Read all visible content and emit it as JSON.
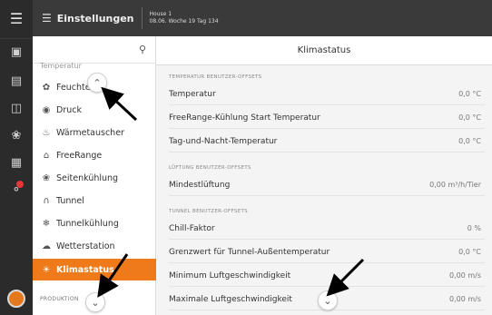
{
  "header": {
    "title": "Einstellungen",
    "house": "House 1",
    "date_line": "08.06. Woche 19 Tag 134"
  },
  "rail": {
    "icons": [
      "menu-icon",
      "dashboard-icon",
      "chart-icon",
      "building-icon",
      "fan-icon",
      "calendar-icon",
      "alarm-icon",
      "avatar"
    ]
  },
  "nav": {
    "partial_item": "Temperatur",
    "items": [
      {
        "label": "Feuchte",
        "icon": "drop-icon"
      },
      {
        "label": "Druck",
        "icon": "gauge-icon"
      },
      {
        "label": "Wärmetauscher",
        "icon": "exchange-icon"
      },
      {
        "label": "FreeRange",
        "icon": "house-icon"
      },
      {
        "label": "Seitenkühlung",
        "icon": "fan-icon"
      },
      {
        "label": "Tunnel",
        "icon": "tunnel-icon"
      },
      {
        "label": "Tunnelkühlung",
        "icon": "cooling-icon"
      },
      {
        "label": "Wetterstation",
        "icon": "weather-icon"
      },
      {
        "label": "Klimastatus",
        "icon": "sun-icon",
        "active": true
      }
    ],
    "section_bottom": "PRODUKTION"
  },
  "main": {
    "title": "Klimastatus",
    "sections": [
      {
        "title": "TEMPERATUR BENUTZER-OFFSETS",
        "rows": [
          {
            "label": "Temperatur",
            "value": "0,0 °C"
          },
          {
            "label": "FreeRange-Kühlung Start Temperatur",
            "value": "0,0 °C"
          },
          {
            "label": "Tag-und-Nacht-Temperatur",
            "value": "0,0 °C"
          }
        ]
      },
      {
        "title": "LÜFTUNG BENUTZER-OFFSETS",
        "rows": [
          {
            "label": "Mindestlüftung",
            "value": "0,00 m³/h/Tier"
          }
        ]
      },
      {
        "title": "TUNNEL BENUTZER-OFFSETS",
        "rows": [
          {
            "label": "Chill-Faktor",
            "value": "0 %"
          },
          {
            "label": "Grenzwert für Tunnel-Außentemperatur",
            "value": "0,0 °C"
          },
          {
            "label": "Minimum Luftgeschwindigkeit",
            "value": "0,00 m/s"
          },
          {
            "label": "Maximale Luftgeschwindigkeit",
            "value": "0,00 m/s"
          }
        ]
      }
    ]
  },
  "colors": {
    "accent": "#ef7a1a",
    "rail": "#2b2b2b",
    "header": "#3a3a3a"
  }
}
